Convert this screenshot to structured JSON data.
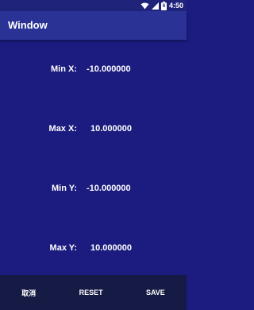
{
  "status_bar": {
    "time": "4:50",
    "battery_level": "6"
  },
  "app_bar": {
    "title": "Window"
  },
  "fields": [
    {
      "label": "Min X:",
      "value": "-10.000000"
    },
    {
      "label": "Max X:",
      "value": "10.000000"
    },
    {
      "label": "Min Y:",
      "value": "-10.000000"
    },
    {
      "label": "Max Y:",
      "value": "10.000000"
    }
  ],
  "bottom_bar": {
    "cancel_label": "取消",
    "reset_label": "RESET",
    "save_label": "SAVE"
  }
}
